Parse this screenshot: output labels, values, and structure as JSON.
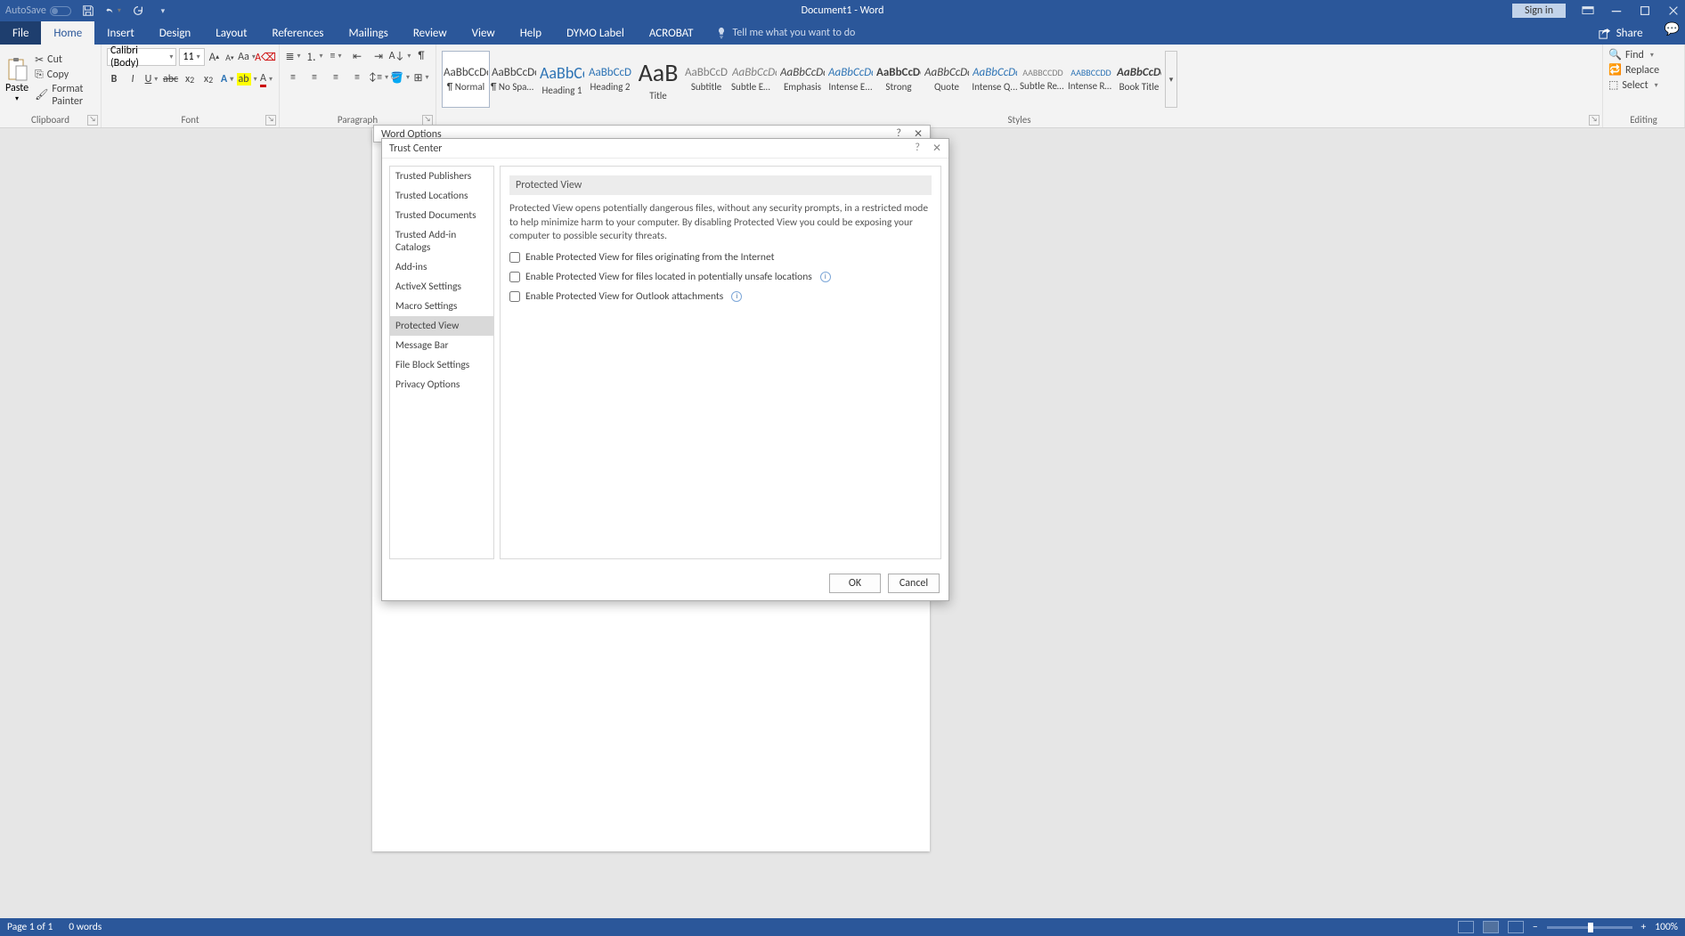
{
  "titlebar": {
    "autosave_label": "AutoSave",
    "autosave_state": "Off",
    "doc_title": "Document1 - Word",
    "signin": "Sign in"
  },
  "tabs": {
    "file": "File",
    "home": "Home",
    "insert": "Insert",
    "design": "Design",
    "layout": "Layout",
    "references": "References",
    "mailings": "Mailings",
    "review": "Review",
    "view": "View",
    "help": "Help",
    "dymo": "DYMO Label",
    "acrobat": "ACROBAT",
    "tellme": "Tell me what you want to do",
    "share": "Share"
  },
  "ribbon": {
    "clipboard": {
      "label": "Clipboard",
      "paste": "Paste",
      "cut": "Cut",
      "copy": "Copy",
      "painter": "Format Painter"
    },
    "font": {
      "label": "Font",
      "name": "Calibri (Body)",
      "size": "11"
    },
    "paragraph": {
      "label": "Paragraph"
    },
    "styles": {
      "label": "Styles",
      "items": [
        {
          "sample": "AaBbCcDd",
          "name": "¶ Normal",
          "bold": false,
          "italic": false,
          "color": "#444",
          "selected": true
        },
        {
          "sample": "AaBbCcDd",
          "name": "¶ No Spac...",
          "bold": false,
          "italic": false,
          "color": "#444"
        },
        {
          "sample": "AaBbCc",
          "name": "Heading 1",
          "bold": false,
          "italic": false,
          "color": "#2e74b5",
          "big": true
        },
        {
          "sample": "AaBbCcD",
          "name": "Heading 2",
          "bold": false,
          "italic": false,
          "color": "#2e74b5"
        },
        {
          "sample": "AaB",
          "name": "Title",
          "bold": false,
          "italic": false,
          "color": "#333",
          "huge": true
        },
        {
          "sample": "AaBbCcD",
          "name": "Subtitle",
          "bold": false,
          "italic": false,
          "color": "#7f7f7f"
        },
        {
          "sample": "AaBbCcDd",
          "name": "Subtle Em...",
          "bold": false,
          "italic": true,
          "color": "#808080"
        },
        {
          "sample": "AaBbCcDd",
          "name": "Emphasis",
          "bold": false,
          "italic": true,
          "color": "#444"
        },
        {
          "sample": "AaBbCcDd",
          "name": "Intense E...",
          "bold": false,
          "italic": true,
          "color": "#2e74b5"
        },
        {
          "sample": "AaBbCcDd",
          "name": "Strong",
          "bold": true,
          "italic": false,
          "color": "#444"
        },
        {
          "sample": "AaBbCcDd",
          "name": "Quote",
          "bold": false,
          "italic": true,
          "color": "#444"
        },
        {
          "sample": "AaBbCcDd",
          "name": "Intense Q...",
          "bold": false,
          "italic": true,
          "color": "#2e74b5"
        },
        {
          "sample": "AABBCCDD",
          "name": "Subtle Ref...",
          "bold": false,
          "italic": false,
          "color": "#808080",
          "small": true
        },
        {
          "sample": "AABBCCDD",
          "name": "Intense Re...",
          "bold": false,
          "italic": false,
          "color": "#2e74b5",
          "small": true
        },
        {
          "sample": "AaBbCcDd",
          "name": "Book Title",
          "bold": true,
          "italic": true,
          "color": "#444"
        }
      ]
    },
    "editing": {
      "label": "Editing",
      "find": "Find",
      "replace": "Replace",
      "select": "Select"
    }
  },
  "options_dialog": {
    "title": "Word Options"
  },
  "trust_center": {
    "title": "Trust Center",
    "nav": [
      "Trusted Publishers",
      "Trusted Locations",
      "Trusted Documents",
      "Trusted Add-in Catalogs",
      "Add-ins",
      "ActiveX Settings",
      "Macro Settings",
      "Protected View",
      "Message Bar",
      "File Block Settings",
      "Privacy Options"
    ],
    "nav_selected": "Protected View",
    "heading": "Protected View",
    "description": "Protected View opens potentially dangerous files, without any security prompts, in a restricted mode to help minimize harm to your computer. By disabling Protected View you could be exposing your computer to possible security threats.",
    "check1": "Enable Protected View for files originating from the Internet",
    "check2": "Enable Protected View for files located in potentially unsafe locations",
    "check3": "Enable Protected View for Outlook attachments",
    "ok": "OK",
    "cancel": "Cancel"
  },
  "statusbar": {
    "page": "Page 1 of 1",
    "words": "0 words",
    "zoom": "100%",
    "zoom_minus": "−",
    "zoom_plus": "+"
  }
}
